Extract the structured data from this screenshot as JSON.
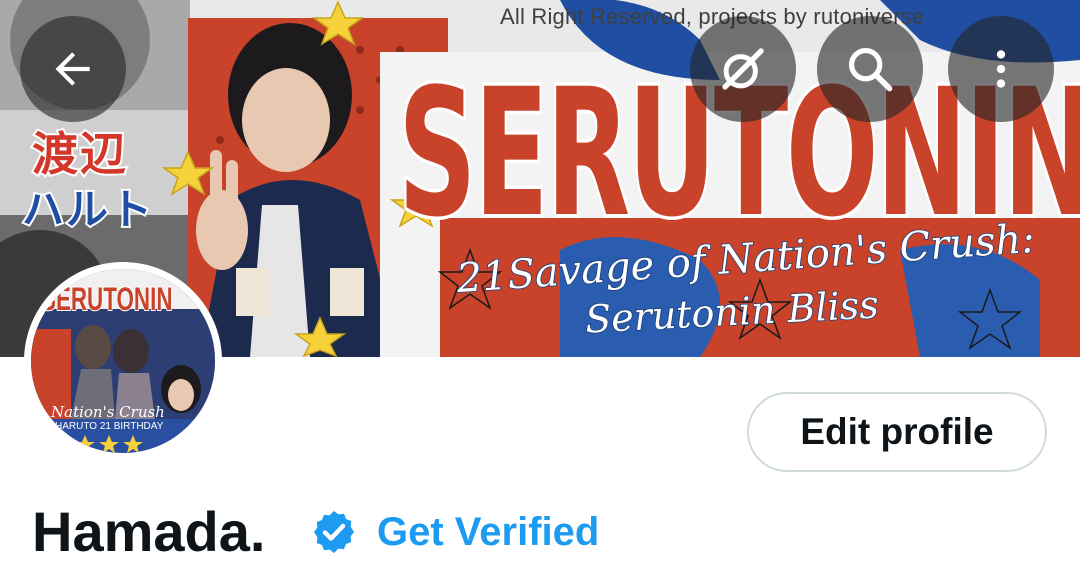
{
  "banner": {
    "credit_text": "All Right Reserved, projects by rutoniverse",
    "title_art": "SERUTONIN",
    "script_line_1": "21Savage of Nation's Crush:",
    "script_line_2": "Serutonin Bliss",
    "jp_line_1": "渡辺",
    "jp_line_2": "ハルト"
  },
  "avatar": {
    "title_art": "SERUTONIN",
    "script": "Nation's Crush",
    "subtitle": "HARUTO 21 BIRTHDAY"
  },
  "top_bar": {
    "back_icon": "arrow-left-icon",
    "grok_icon": "grok-slash-icon",
    "search_icon": "search-icon",
    "more_icon": "more-vertical-icon"
  },
  "profile": {
    "edit_label": "Edit profile",
    "display_name": "Hamada.",
    "verify_label": "Get Verified"
  },
  "colors": {
    "accent": "#1d9bf0",
    "text": "#0f1419",
    "border": "#cfd9de",
    "banner_red": "#c9432a",
    "banner_blue": "#1f4ea3"
  }
}
